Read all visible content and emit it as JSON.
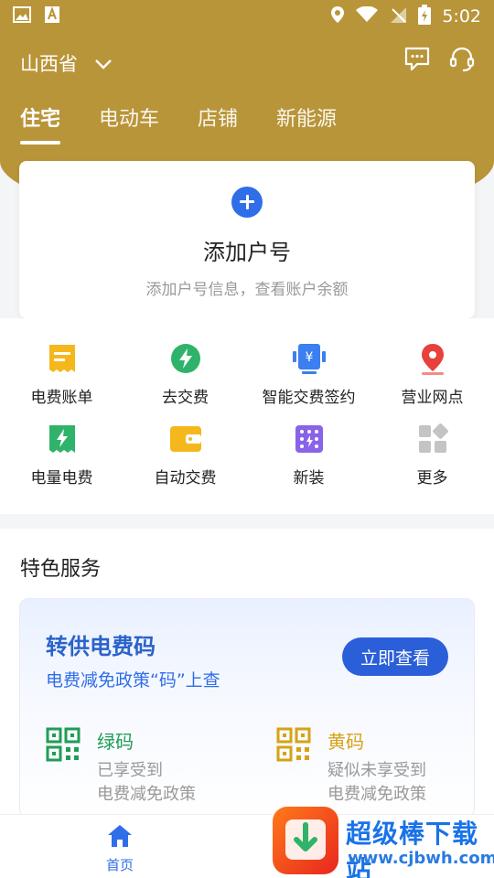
{
  "status_bar": {
    "time": "5:02"
  },
  "header": {
    "province": "山西省"
  },
  "tabs": [
    {
      "label": "住宅",
      "active": true
    },
    {
      "label": "电动车",
      "active": false
    },
    {
      "label": "店铺",
      "active": false
    },
    {
      "label": "新能源",
      "active": false
    }
  ],
  "add_account": {
    "title": "添加户号",
    "subtitle": "添加户号信息，查看账户余额"
  },
  "grid": [
    {
      "label": "电费账单",
      "icon": "bill-icon",
      "color": "#f5b81c"
    },
    {
      "label": "去交费",
      "icon": "lightning-pay-icon",
      "color": "#2fb36a"
    },
    {
      "label": "智能交费签约",
      "icon": "smart-pay-icon",
      "color": "#3b7ff0"
    },
    {
      "label": "营业网点",
      "icon": "location-pin-icon",
      "color": "#e8403a"
    },
    {
      "label": "电量电费",
      "icon": "electricity-icon",
      "color": "#2fb36a"
    },
    {
      "label": "自动交费",
      "icon": "wallet-icon",
      "color": "#f5b81c"
    },
    {
      "label": "新装",
      "icon": "meter-icon",
      "color": "#8a63e8"
    },
    {
      "label": "更多",
      "icon": "more-icon",
      "color": "#c4c4c4"
    }
  ],
  "services": {
    "title": "特色服务",
    "card": {
      "title": "转供电费码",
      "subtitle": "电费减免政策“码”上查",
      "button": "立即查看",
      "green": {
        "name": "绿码",
        "line1": "已享受到",
        "line2": "电费减免政策"
      },
      "yellow": {
        "name": "黄码",
        "line1": "疑似未享受到",
        "line2": "电费减免政策"
      }
    }
  },
  "bottom_nav": {
    "home_label": "首页"
  },
  "watermark": {
    "text": "超级棒下载站",
    "url": "www.cjbwh.com"
  },
  "colors": {
    "header": "#b99539",
    "primary": "#2f6ee8",
    "green": "#1f9d55",
    "yellow": "#d6a214"
  }
}
